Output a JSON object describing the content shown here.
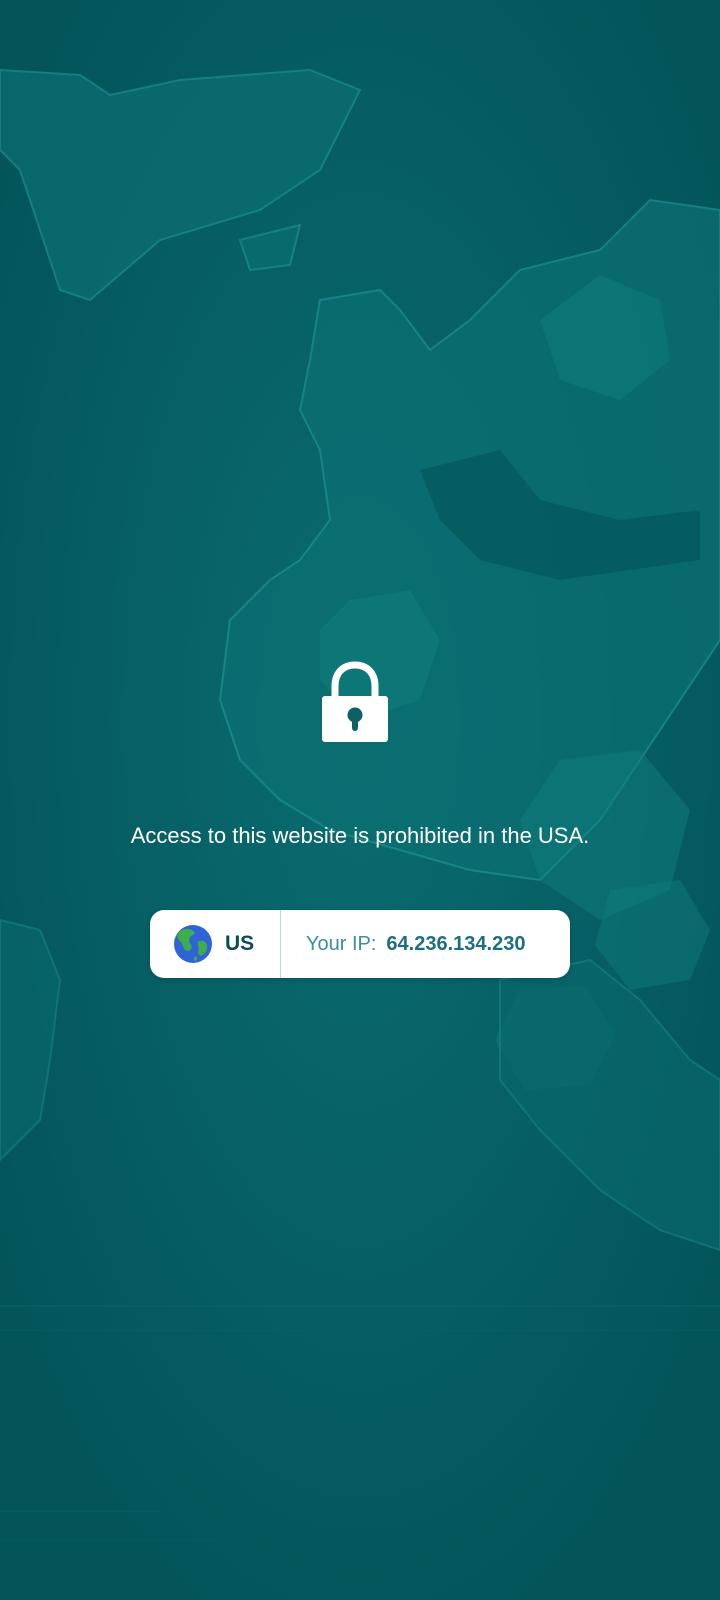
{
  "page": {
    "message": "Access to this website is prohibited in the USA.",
    "lock_icon": "padlock-icon"
  },
  "ip_card": {
    "country_icon": "globe-icon",
    "country_code": "US",
    "ip_label": "Your IP:",
    "ip_value": "64.236.134.230"
  },
  "colors": {
    "background": "#03555a",
    "map_teal": "#0b7a7c",
    "card_background": "#ffffff",
    "country_text": "#0d4c5a",
    "ip_label_text": "#3d8d9c",
    "ip_value_text": "#1d6f80"
  }
}
